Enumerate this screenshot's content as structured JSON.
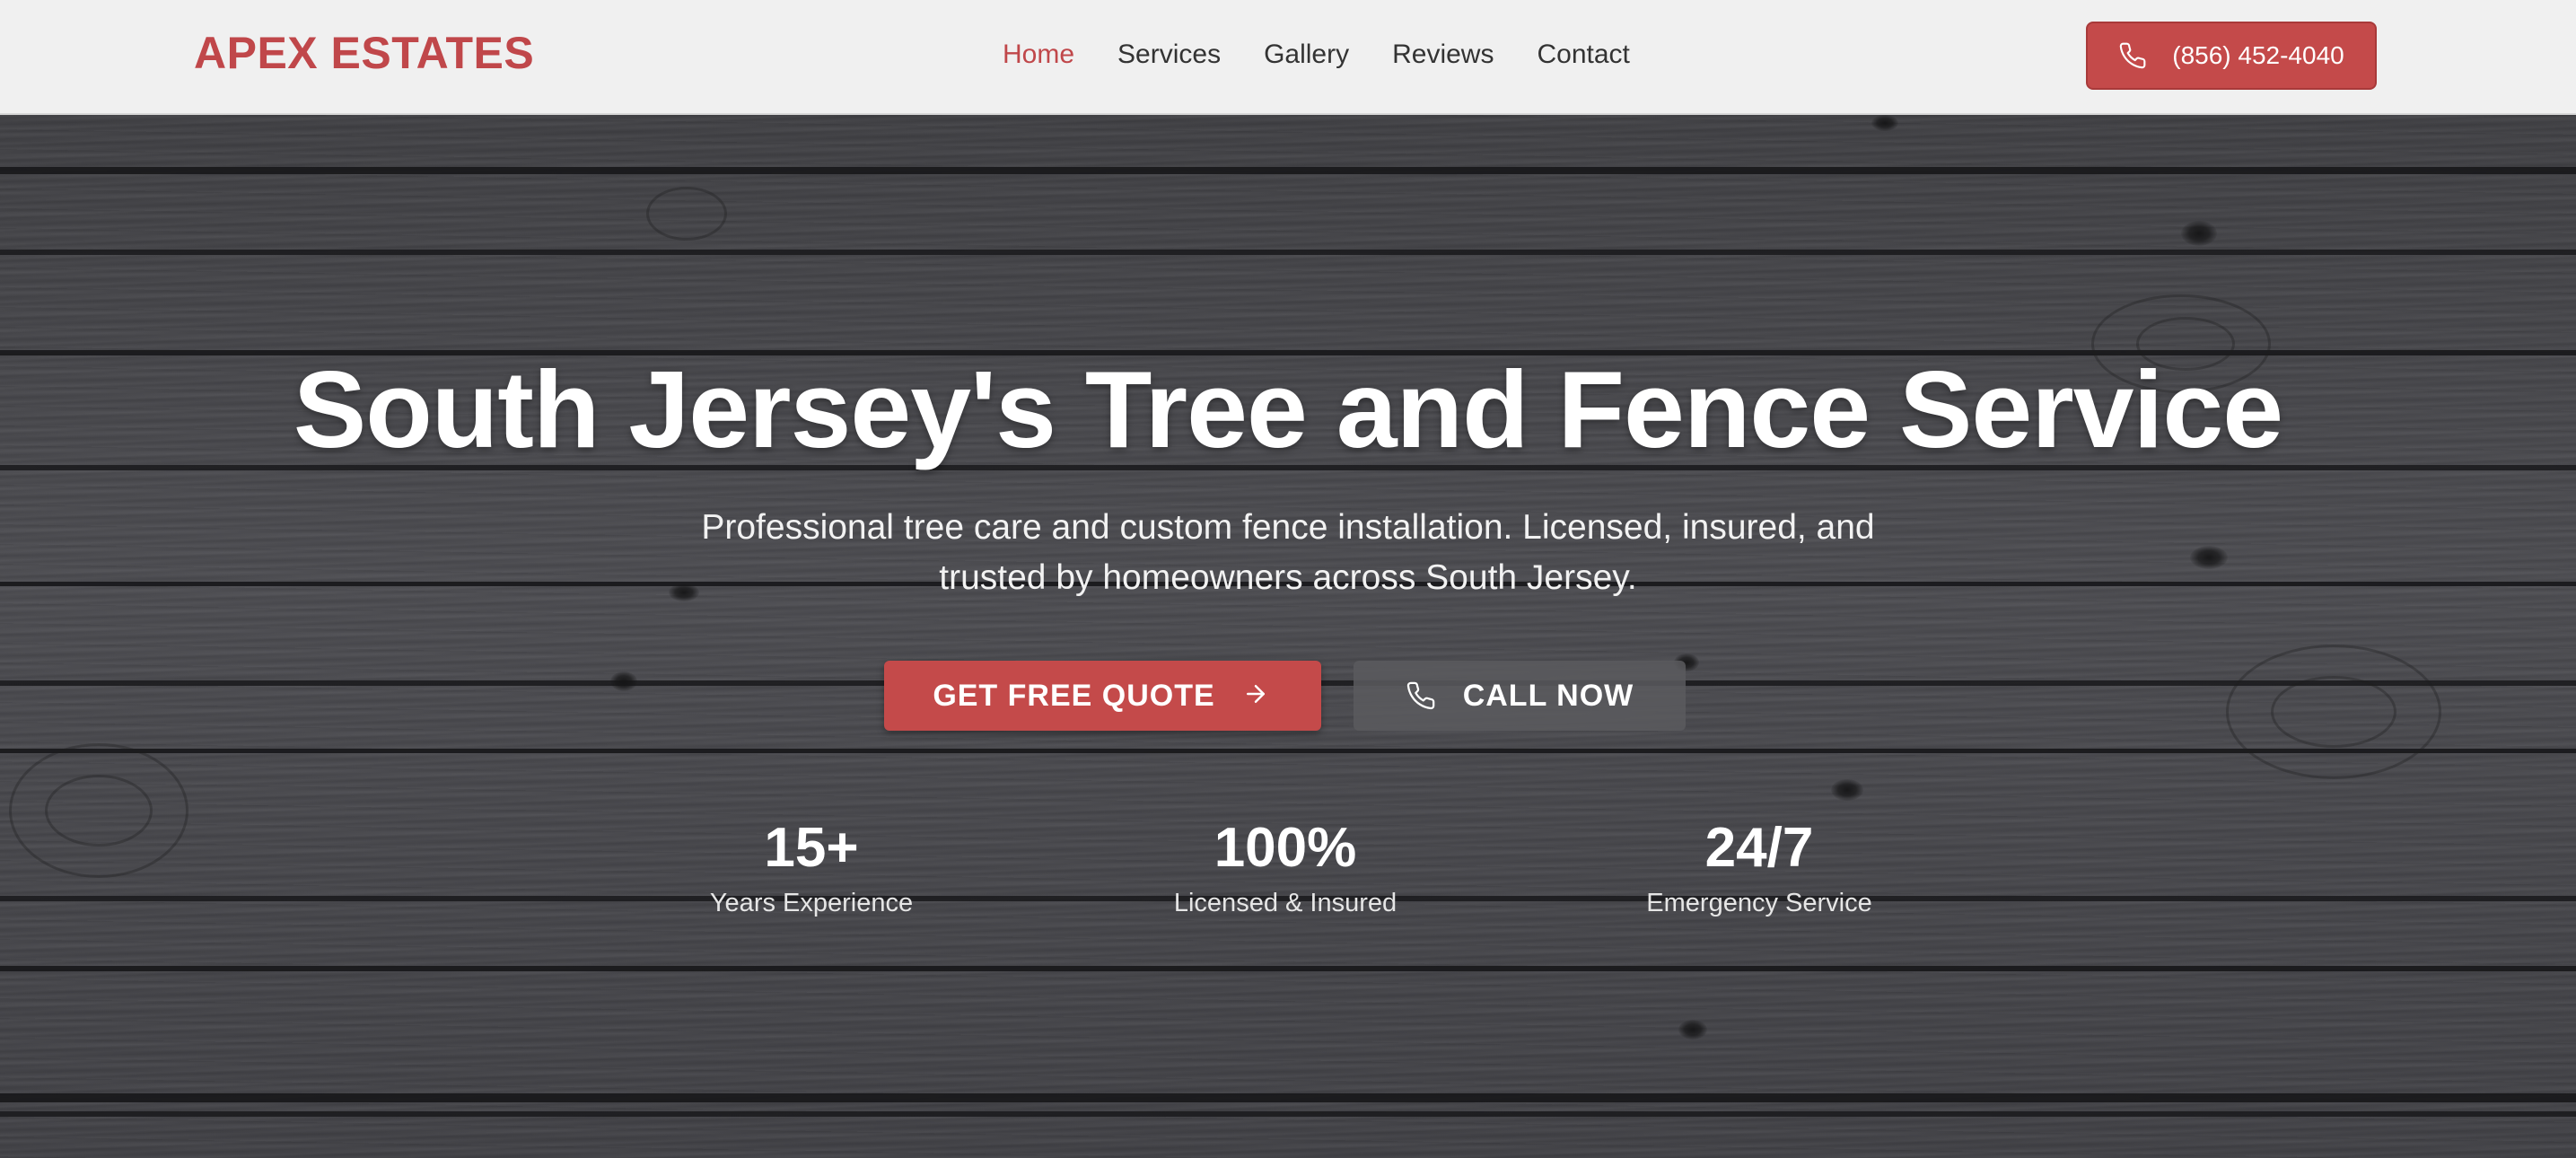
{
  "nav": {
    "brand": "APEX ESTATES",
    "links": [
      "Home",
      "Services",
      "Gallery",
      "Reviews",
      "Contact"
    ],
    "active_link": "Home",
    "phone": "(856) 452-4040"
  },
  "hero": {
    "title": "South Jersey's Tree and Fence Service",
    "subtitle": "Professional tree care and custom fence installation. Licensed, insured, and trusted by homeowners across South Jersey.",
    "primary_button": "GET FREE QUOTE",
    "secondary_button": "CALL NOW"
  },
  "stats": [
    {
      "value": "15+",
      "label": "Years Experience"
    },
    {
      "value": "100%",
      "label": "Licensed & Insured"
    },
    {
      "value": "24/7",
      "label": "Emergency Service"
    }
  ],
  "icons": {
    "phone": "phone-icon",
    "arrow": "arrow-right-icon"
  },
  "colors": {
    "accent": "#c44a4a",
    "brand": "#c0474a",
    "nav_background": "#f0f0f0",
    "hero_text": "#ffffff"
  }
}
